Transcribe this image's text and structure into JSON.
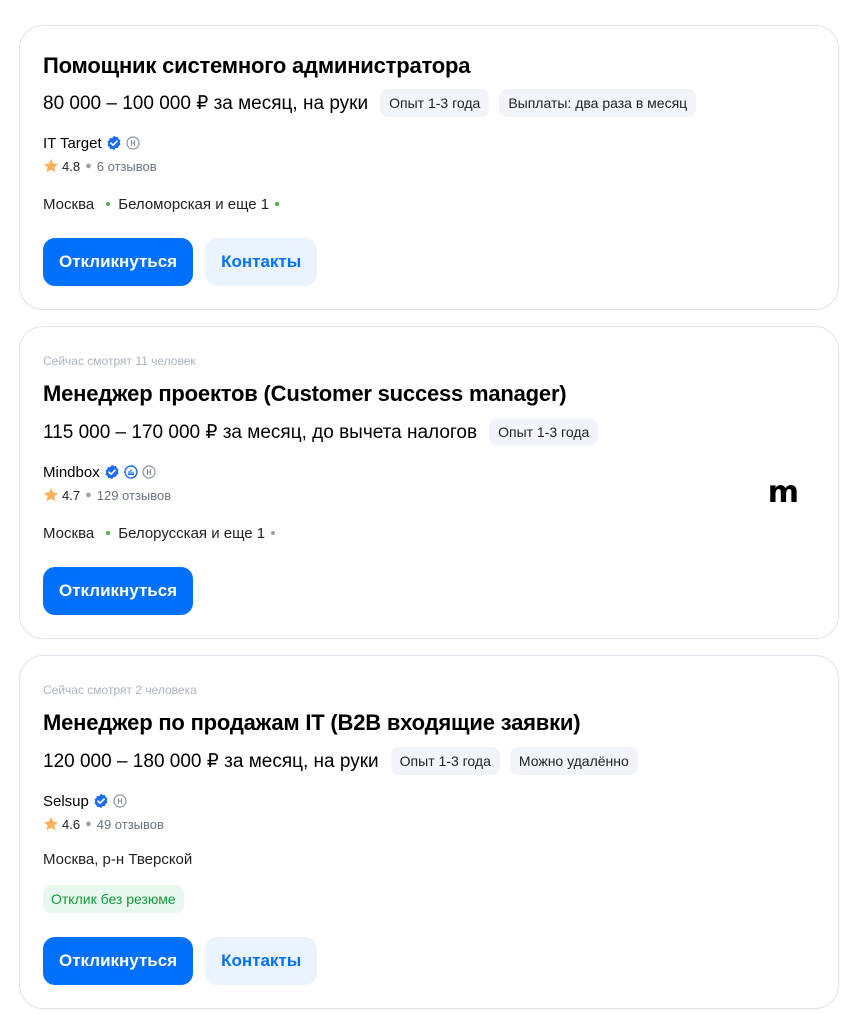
{
  "vacancies": [
    {
      "title": "Помощник системного администратора",
      "salary": "80 000 – 100 000 ₽ за месяц, на руки",
      "tags": [
        "Опыт 1-3 года",
        "Выплаты: два раза в месяц"
      ],
      "company": "IT Target",
      "rating": "4.8",
      "reviews": "6 отзывов",
      "city": "Москва",
      "metro": "Беломорская и еще 1",
      "metro_color": "#4caf50",
      "apply_label": "Откликнуться",
      "contacts_label": "Контакты"
    },
    {
      "watching": "Сейчас смотрят 11 человек",
      "title": "Менеджер проектов (Customer success manager)",
      "salary": "115 000 – 170 000 ₽ за месяц, до вычета налогов",
      "tags": [
        "Опыт 1-3 года"
      ],
      "company": "Mindbox",
      "rating": "4.7",
      "reviews": "129 отзывов",
      "city": "Москва",
      "metro": "Белорусская и еще 1",
      "metro_color": "#4caf50",
      "logo_text": "m",
      "apply_label": "Откликнуться"
    },
    {
      "watching": "Сейчас смотрят 2 человека",
      "title": "Менеджер по продажам IT (B2B входящие заявки)",
      "salary": "120 000 – 180 000 ₽ за месяц, на руки",
      "tags": [
        "Опыт 1-3 года",
        "Можно удалённо"
      ],
      "company": "Selsup",
      "rating": "4.6",
      "reviews": "49 отзывов",
      "city": "Москва, р-н Тверской",
      "badge": "Отклик без резюме",
      "apply_label": "Откликнуться",
      "contacts_label": "Контакты"
    }
  ],
  "colors": {
    "primary": "#0070ff",
    "verified": "#1e6cf2",
    "star": "#ffb05c",
    "success": "#0f9b3c"
  }
}
